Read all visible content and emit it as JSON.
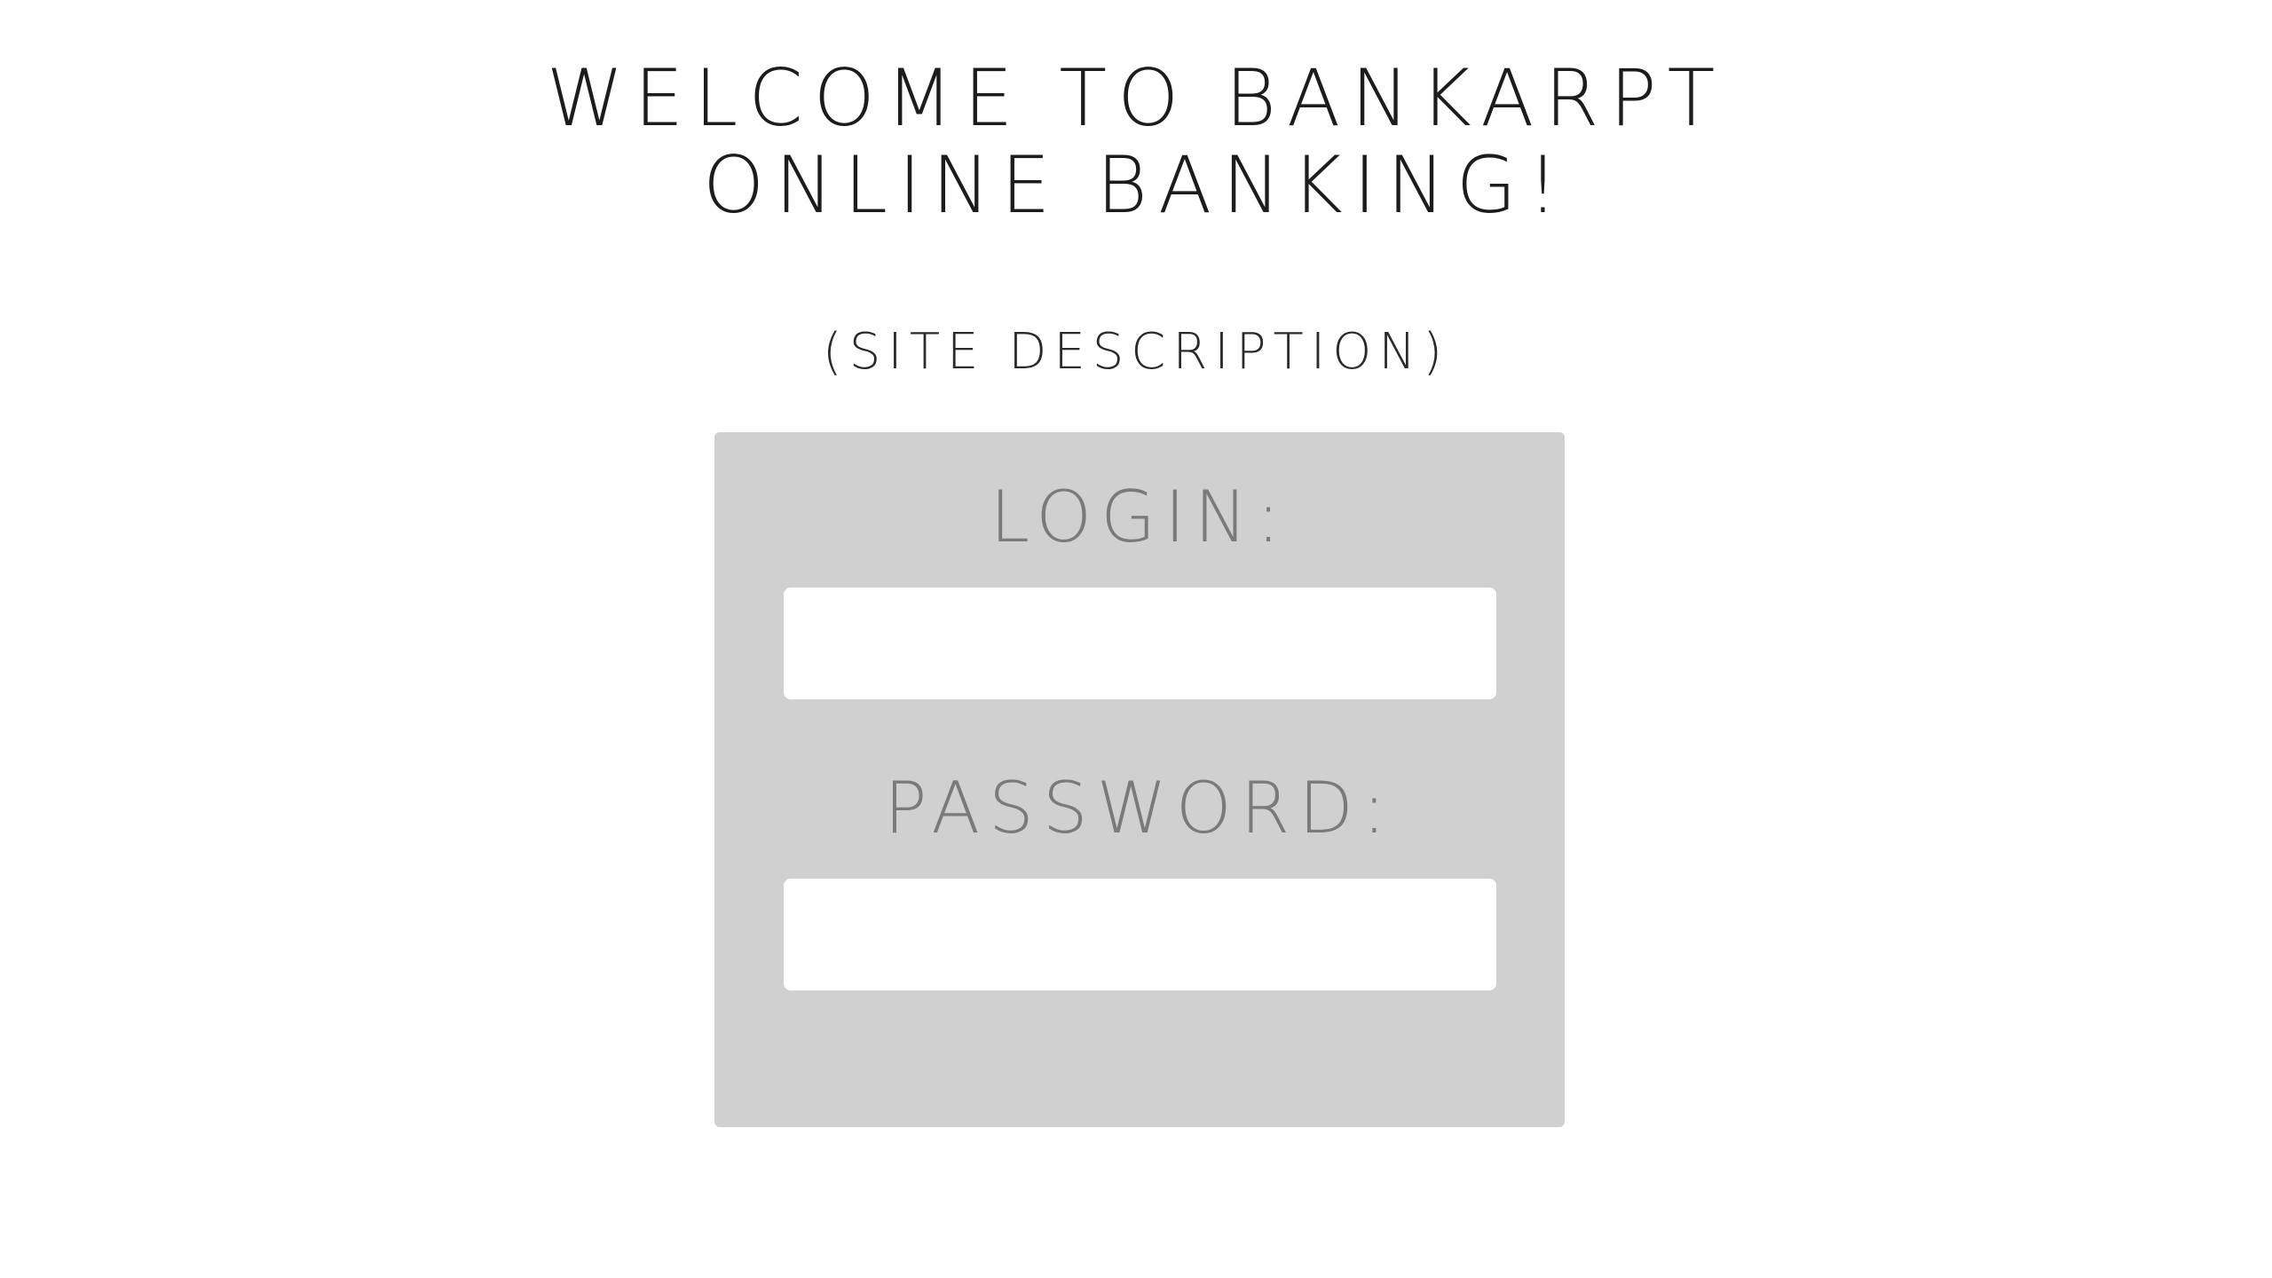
{
  "header": {
    "title_line1": "WELCOME TO BANKARPT",
    "title_line2": "ONLINE BANKING!",
    "subtitle": "(SITE DESCRIPTION)"
  },
  "login_form": {
    "login_label": "LOGIN:",
    "login_value": "",
    "password_label": "PASSWORD:",
    "password_value": ""
  },
  "colors": {
    "background": "#ffffff",
    "panel": "#d0d0d0",
    "field": "#ffffff",
    "label_text": "#7a7a7a",
    "title_text": "#1c1c1c"
  }
}
